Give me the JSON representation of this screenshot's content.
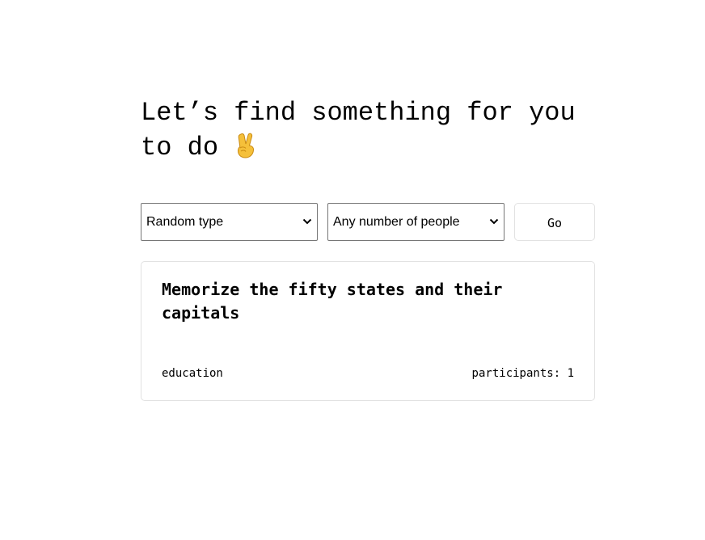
{
  "header": {
    "title": "Let’s find something for you to do",
    "emoji_icon": "victory-hand-icon"
  },
  "filters": {
    "type_select": {
      "selected": "Random type"
    },
    "participants_select": {
      "selected": "Any number of people"
    },
    "go_label": "Go"
  },
  "activity": {
    "title": "Memorize the fifty states and their capitals",
    "type": "education",
    "participants_label": "participants:",
    "participants": "1"
  },
  "colors": {
    "emoji": "#f5c03a",
    "border": "#e2e2e2",
    "select_border": "#767676"
  }
}
